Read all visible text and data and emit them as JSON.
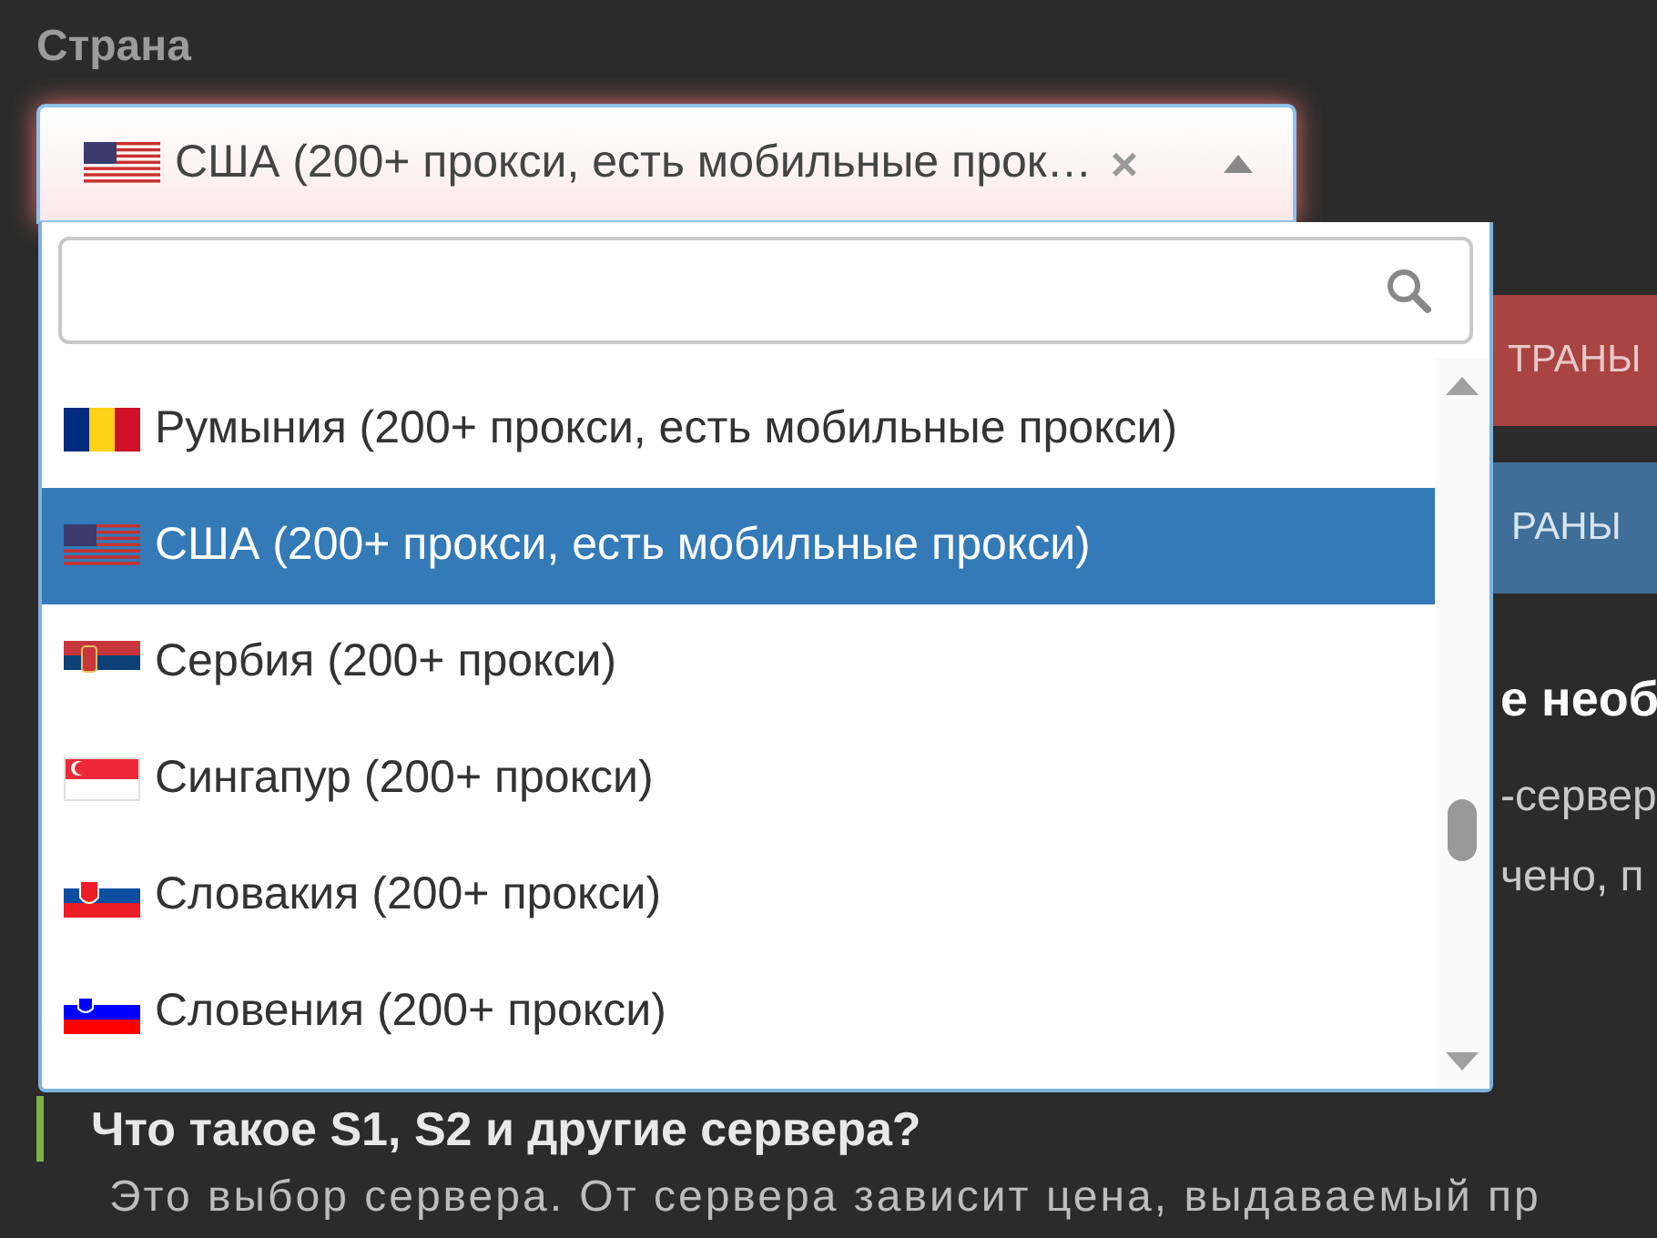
{
  "field_label": "Страна",
  "select": {
    "kind": "us",
    "value": "США (200+ прокси, есть мобильные прок…",
    "clear": "×",
    "expanded": true
  },
  "options": [
    {
      "kind": "ro",
      "label": "Румыния (200+ прокси, есть мобильные прокси)",
      "selected": false
    },
    {
      "kind": "us",
      "label": "США (200+ прокси, есть мобильные прокси)",
      "selected": true
    },
    {
      "kind": "rs",
      "label": "Сербия (200+ прокси)",
      "selected": false
    },
    {
      "kind": "sg",
      "label": "Сингапур (200+ прокси)",
      "selected": false
    },
    {
      "kind": "sk",
      "label": "Словакия (200+ прокси)",
      "selected": false
    },
    {
      "kind": "si",
      "label": "Словения (200+ прокси)",
      "selected": false
    }
  ],
  "background": {
    "red_button": "ТРАНЫ",
    "blue_button": "РАНЫ",
    "heading_fragment": "е необ",
    "text_fragments": [
      "-сервер",
      "чено, п"
    ],
    "section_heading": "Что такое S1, S2 и другие сервера?",
    "paragraph": "Это выбор сервера. От сервера зависит цена, выдаваемый пр"
  }
}
